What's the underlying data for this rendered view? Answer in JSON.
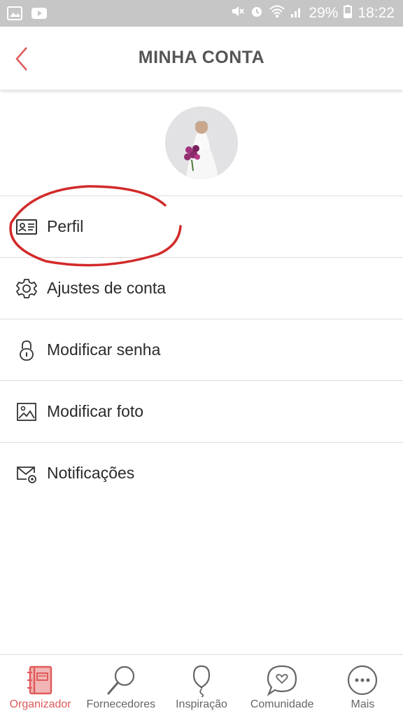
{
  "status_bar": {
    "battery": "29%",
    "time": "18:22"
  },
  "header": {
    "title": "MINHA CONTA"
  },
  "menu": {
    "items": [
      {
        "label": "Perfil",
        "icon": "profile-card-icon"
      },
      {
        "label": "Ajustes de conta",
        "icon": "gear-icon"
      },
      {
        "label": "Modificar senha",
        "icon": "lock-icon"
      },
      {
        "label": "Modificar foto",
        "icon": "image-icon"
      },
      {
        "label": "Notificações",
        "icon": "mail-gear-icon"
      }
    ]
  },
  "bottom_nav": {
    "items": [
      {
        "label": "Organizador",
        "icon": "notebook-icon",
        "active": true
      },
      {
        "label": "Fornecedores",
        "icon": "magnifier-icon",
        "active": false
      },
      {
        "label": "Inspiração",
        "icon": "balloon-icon",
        "active": false
      },
      {
        "label": "Comunidade",
        "icon": "chat-heart-icon",
        "active": false
      },
      {
        "label": "Mais",
        "icon": "more-dots-icon",
        "active": false
      }
    ]
  },
  "colors": {
    "accent": "#e05a5a",
    "annotation": "#d22a2a",
    "status_bar": "#c6c6c6",
    "text": "#2b2b2b"
  }
}
